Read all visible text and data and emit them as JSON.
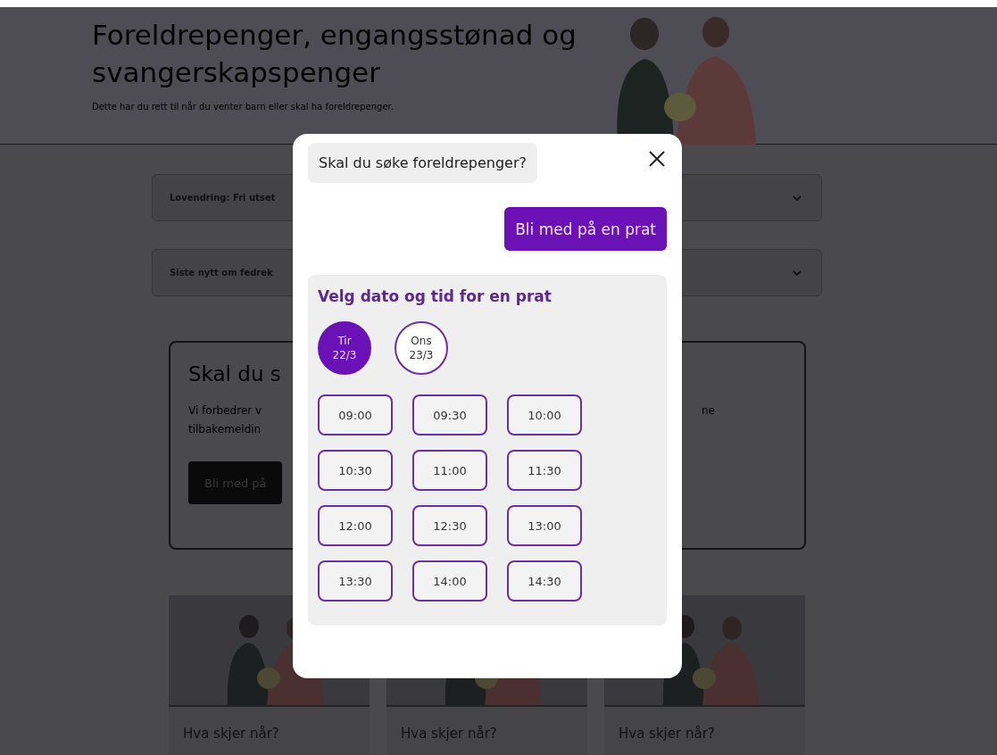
{
  "page": {
    "title": "Foreldrepenger, engangsstønad og svangerskapspenger",
    "subtitle": "Dette har du rett til når du venter barn eller skal ha foreldrepenger.",
    "accordions": [
      {
        "label": "Lovendring: Fri utset",
        "expanded": false
      },
      {
        "label": "Siste nytt om fedrek",
        "expanded": false
      }
    ],
    "promo_card": {
      "title": "Skal du s",
      "text_lines": [
        "Vi forbedrer v",
        "tilbakemeldin"
      ],
      "text_right": "ne",
      "button": "Bli med på"
    },
    "cards": [
      {
        "title": "Hva skjer når?"
      },
      {
        "title": "Hva skjer når?"
      },
      {
        "title": "Hva skjer når?"
      }
    ]
  },
  "dialog": {
    "question": "Skal du søke foreldrepenger?",
    "reply_button": "Bli med på en prat",
    "picker": {
      "title": "Velg dato og tid for en prat",
      "dates": [
        {
          "day": "Tir",
          "date": "22/3",
          "selected": true
        },
        {
          "day": "Ons",
          "date": "23/3",
          "selected": false
        }
      ],
      "times": [
        "09:00",
        "09:30",
        "10:00",
        "10:30",
        "11:00",
        "11:30",
        "12:00",
        "12:30",
        "13:00",
        "13:30",
        "14:00",
        "14:30"
      ]
    }
  }
}
